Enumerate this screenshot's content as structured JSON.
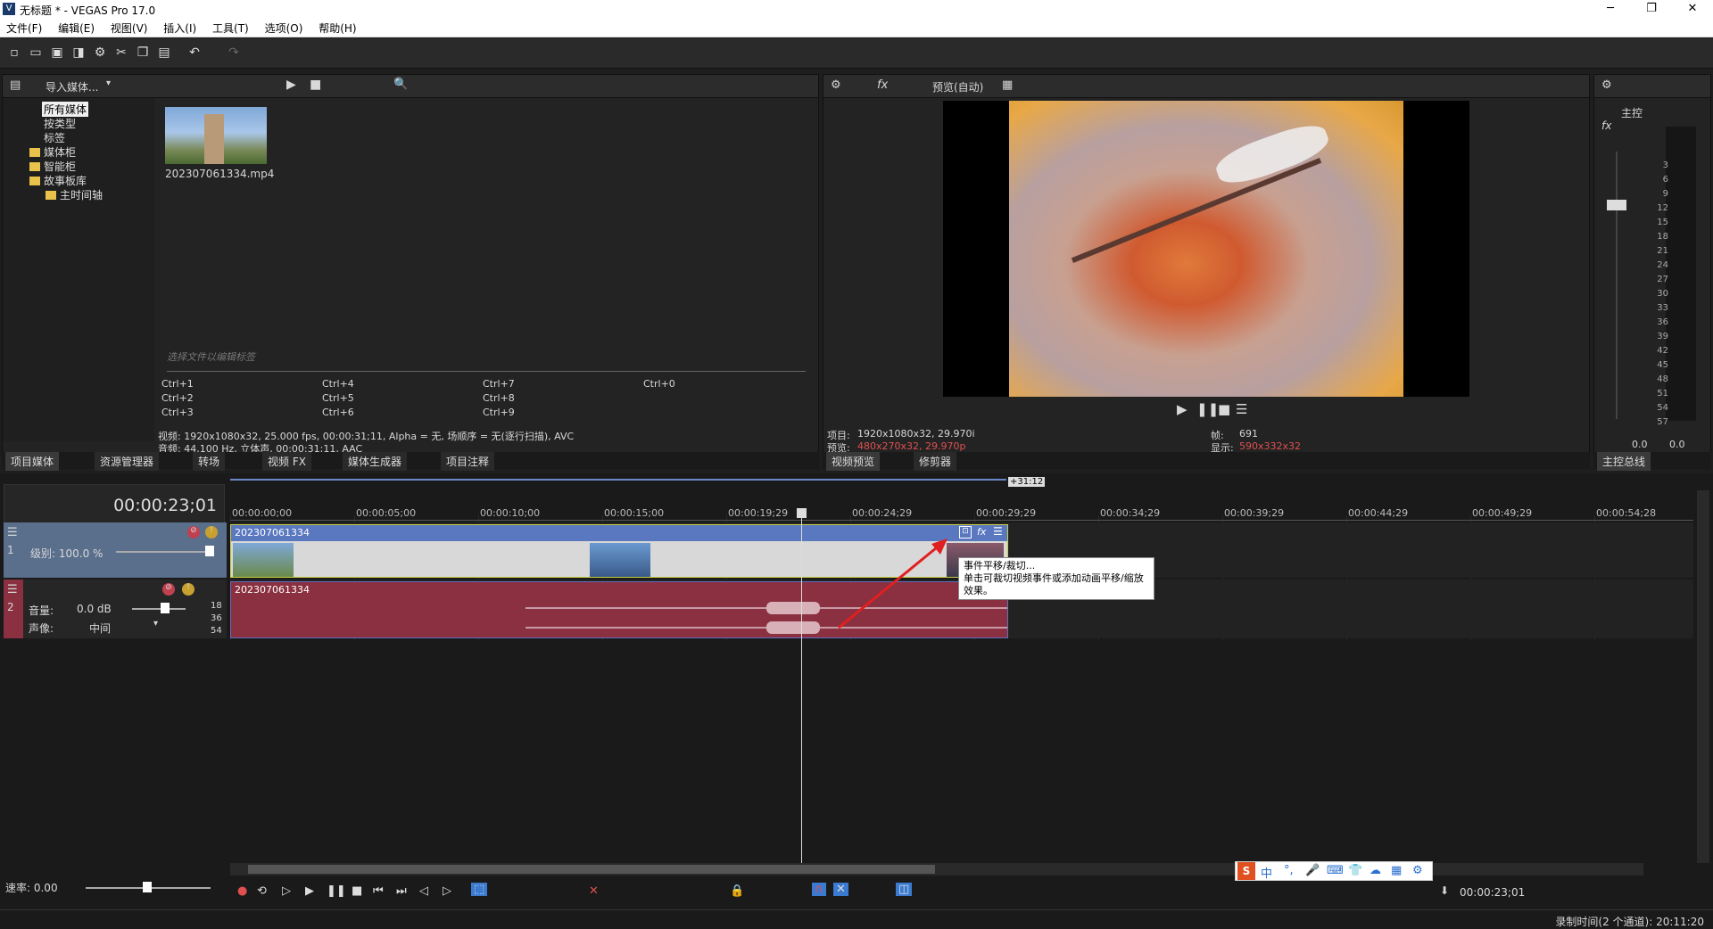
{
  "window": {
    "title": "无标题 * - VEGAS Pro 17.0",
    "minimize": "─",
    "restore": "❐",
    "close": "✕"
  },
  "menu": [
    "文件(F)",
    "编辑(E)",
    "视图(V)",
    "插入(I)",
    "工具(T)",
    "选项(O)",
    "帮助(H)"
  ],
  "media_panel": {
    "import_label": "导入媒体...",
    "tree": [
      "所有媒体",
      "按类型",
      "标签",
      "媒体柜",
      "智能柜",
      "故事板库",
      "主时间轴"
    ],
    "file_name": "202307061334.mp4",
    "tag_placeholder": "选择文件以编辑标签",
    "shortcuts": [
      "Ctrl+1",
      "Ctrl+2",
      "Ctrl+3",
      "Ctrl+4",
      "Ctrl+5",
      "Ctrl+6",
      "Ctrl+7",
      "Ctrl+8",
      "Ctrl+9",
      "Ctrl+0"
    ],
    "video_info": "视频: 1920x1080x32, 25.000 fps, 00:00:31;11, Alpha = 无, 场顺序 = 无(逐行扫描), AVC",
    "audio_info": "音频: 44,100 Hz, 立体声, 00:00:31;11, AAC",
    "tabs": [
      "项目媒体",
      "资源管理器",
      "转场",
      "视频 FX",
      "媒体生成器",
      "项目注释"
    ]
  },
  "preview": {
    "mode": "预览(自动)",
    "project_label": "项目:",
    "project_value": "1920x1080x32, 29.970i",
    "preview_label": "预览:",
    "preview_value": "480x270x32, 29.970p",
    "frame_label": "帧:",
    "frame_value": "691",
    "display_label": "显示:",
    "display_value": "590x332x32",
    "tabs": [
      "视频预览",
      "修剪器"
    ]
  },
  "master": {
    "title": "主控",
    "scale": [
      "3",
      "6",
      "9",
      "12",
      "15",
      "18",
      "21",
      "24",
      "27",
      "30",
      "33",
      "36",
      "39",
      "42",
      "45",
      "48",
      "51",
      "54",
      "57"
    ],
    "left_value": "0.0",
    "right_value": "0.0",
    "tab": "主控总线"
  },
  "timeline": {
    "time": "00:00:23;01",
    "end_marker": "+31:12",
    "ruler": [
      "00:00:00;00",
      "00:00:05;00",
      "00:00:10;00",
      "00:00:15;00",
      "00:00:19;29",
      "00:00:24;29",
      "00:00:29;29",
      "00:00:34;29",
      "00:00:39;29",
      "00:00:44;29",
      "00:00:49;29",
      "00:00:54;28"
    ],
    "video_track": {
      "number": "1",
      "level_label": "级别: 100.0 %",
      "clip_name": "202307061334"
    },
    "audio_track": {
      "number": "2",
      "volume_label": "音量:",
      "volume_value": "0.0 dB",
      "pan_label": "声像:",
      "pan_value": "中间",
      "clip_name": "202307061334",
      "db_marks": [
        "18",
        "36",
        "54"
      ]
    },
    "tooltip_title": "事件平移/裁切...",
    "tooltip_body": "单击可裁切视频事件或添加动画平移/缩放效果。",
    "rate_label": "速率: 0.00",
    "transport_time": "00:00:23;01",
    "record_time": "录制时间(2 个通道): 20:11:20"
  },
  "ime": [
    "中",
    "°,",
    "🎤",
    "⌨",
    "👕",
    "☁",
    "▦",
    "⚙"
  ],
  "colors": {
    "video_clip": "#5a78c0",
    "audio_clip": "#8a3040",
    "selected_track": "#5a6f8c",
    "accent_red": "#e05050"
  }
}
